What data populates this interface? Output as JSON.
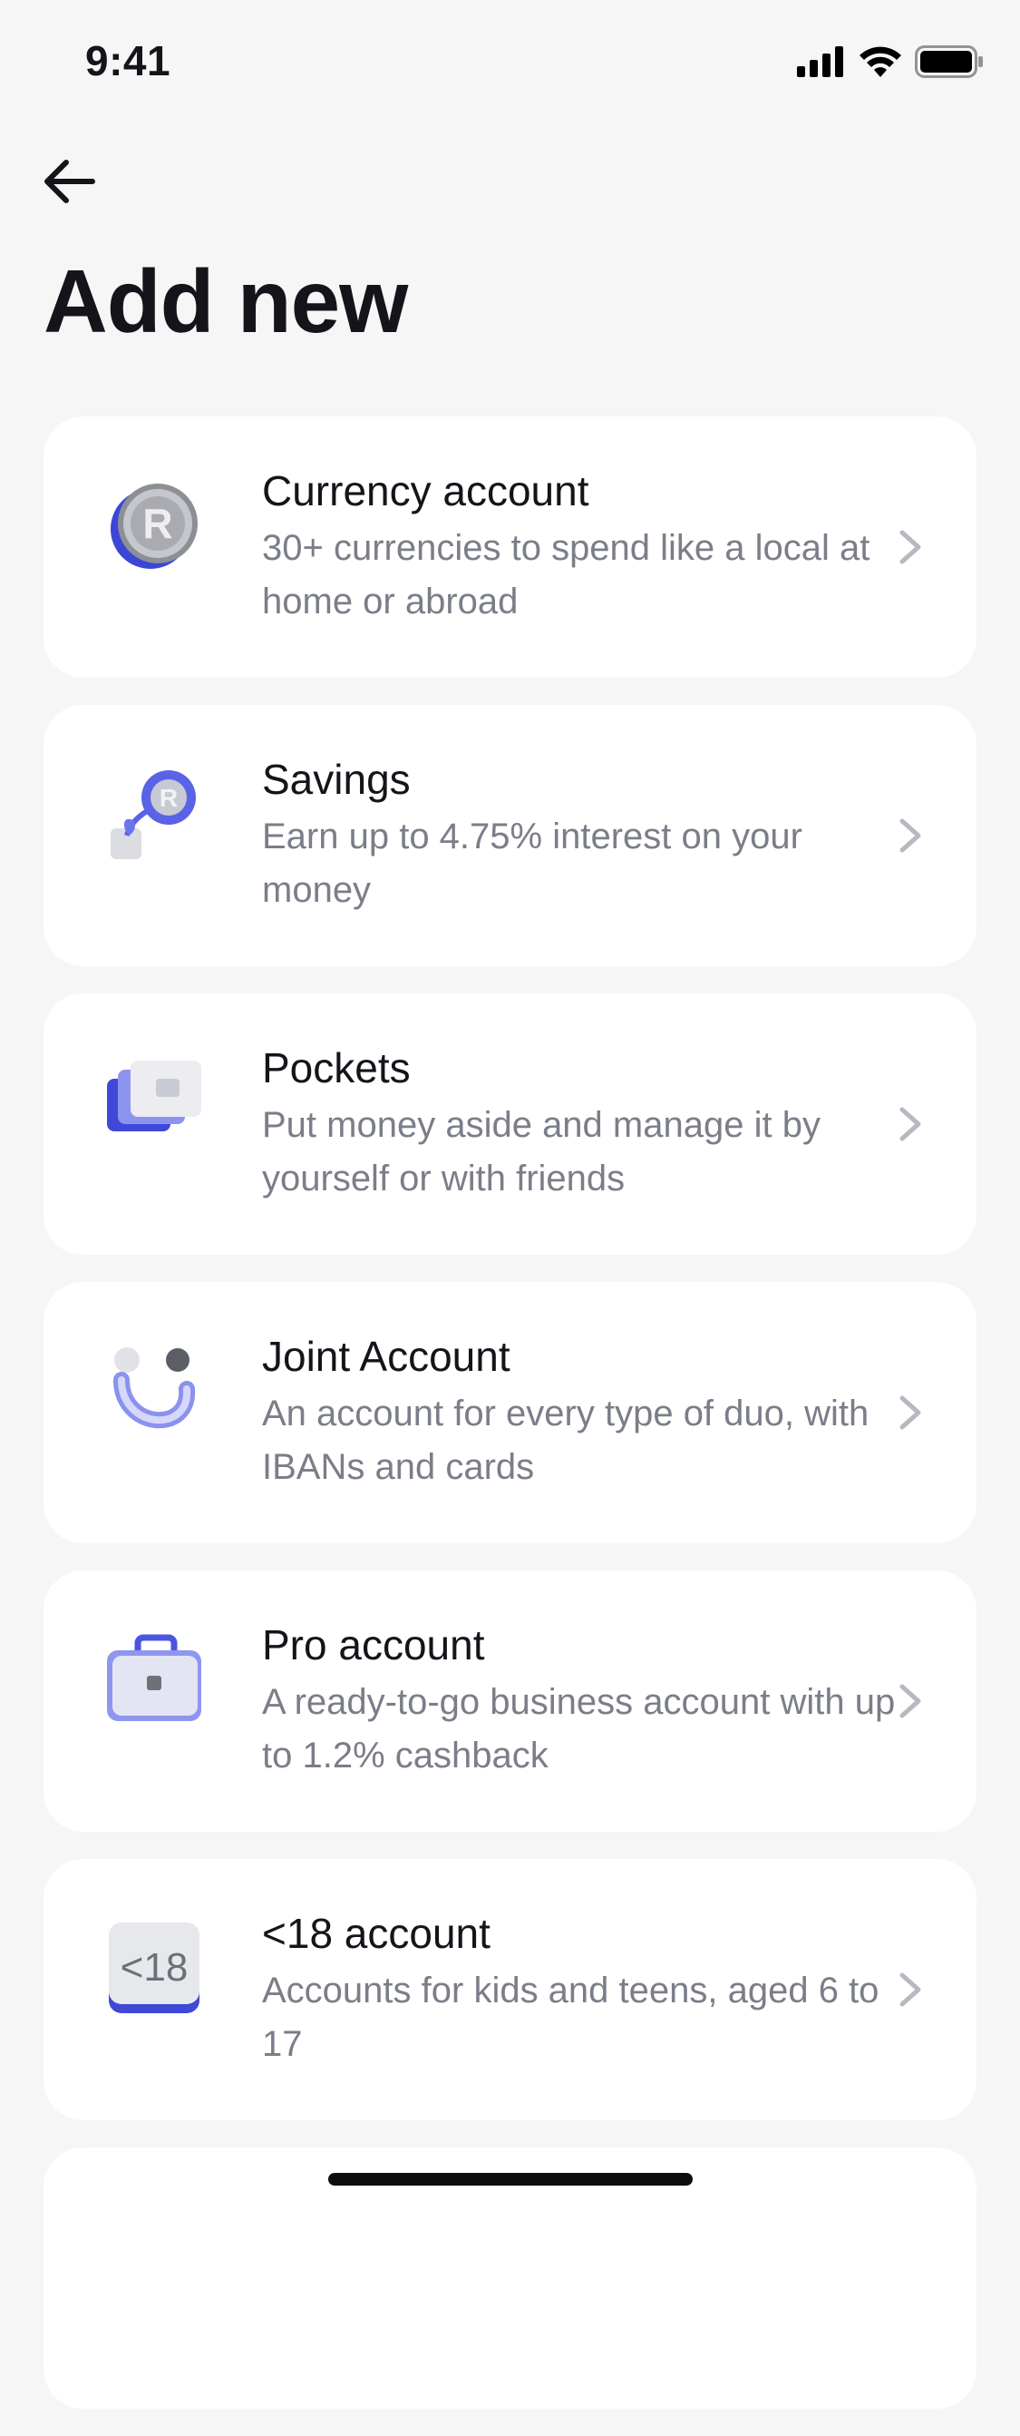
{
  "status_bar": {
    "time": "9:41"
  },
  "header": {
    "title": "Add new"
  },
  "items": [
    {
      "title": "Currency account",
      "description": "30+ currencies to spend like a local at home or abroad",
      "icon": "currency-coin-icon"
    },
    {
      "title": "Savings",
      "description": "Earn up to 4.75% interest on your money",
      "icon": "savings-plant-icon"
    },
    {
      "title": "Pockets",
      "description": "Put money aside and manage it by yourself or with friends",
      "icon": "pockets-wallet-icon"
    },
    {
      "title": "Joint Account",
      "description": "An account for every type of duo, with IBANs and cards",
      "icon": "joint-account-icon"
    },
    {
      "title": "Pro account",
      "description": "A ready-to-go business account with up to 1.2% cashback",
      "icon": "briefcase-icon"
    },
    {
      "title": "<18 account",
      "description": "Accounts for kids and teens, aged 6 to 17",
      "icon": "under-18-badge-icon"
    }
  ],
  "colors": {
    "background": "#f6f6f7",
    "card": "#ffffff",
    "accent": "#4a55e0",
    "muted_text": "#7b7e89",
    "chevron": "#b6b9c2"
  }
}
